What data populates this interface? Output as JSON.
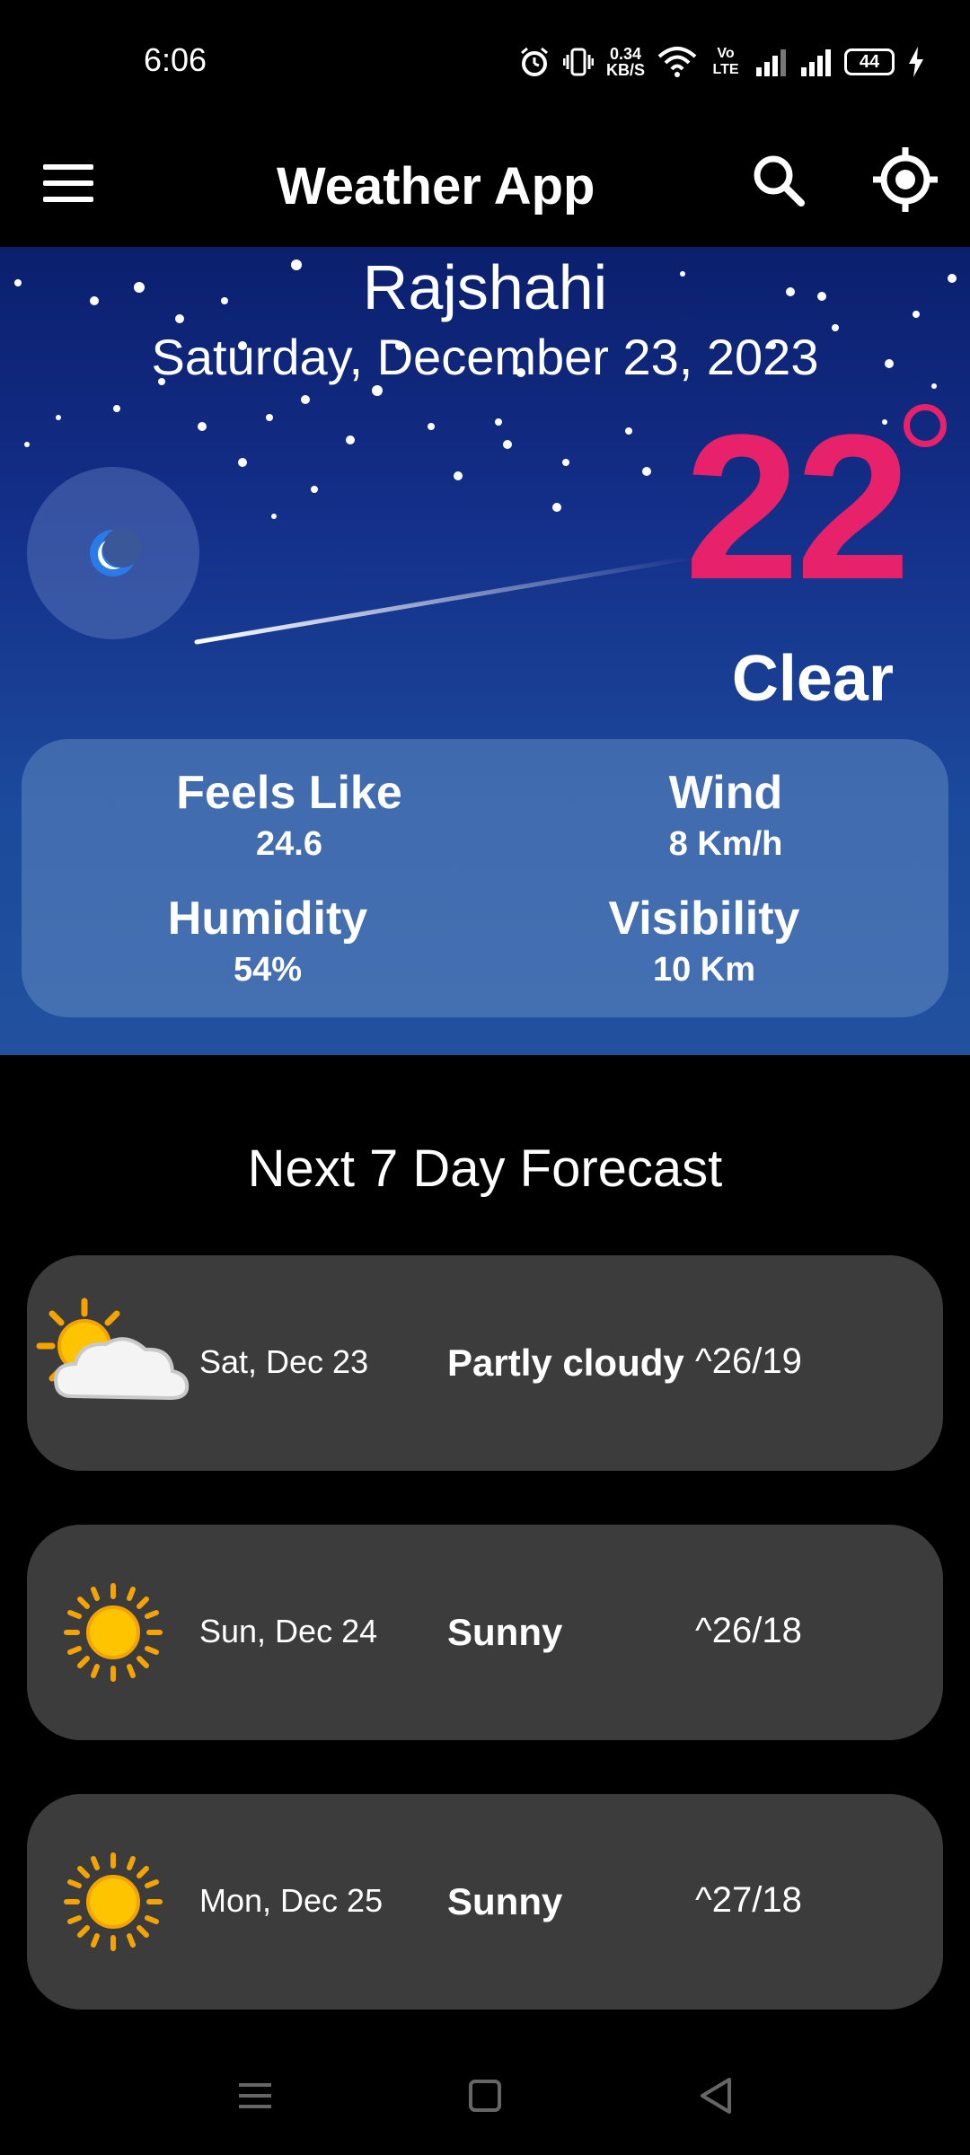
{
  "status_bar": {
    "time": "6:06",
    "net_speed_value": "0.34",
    "net_speed_unit": "KB/S",
    "volte_label": "Vo LTE",
    "battery": "44",
    "icons": [
      "alarm-icon",
      "vibrate-icon",
      "wifi-icon",
      "signal-icon",
      "battery-icon",
      "charging-icon"
    ]
  },
  "app_bar": {
    "title": "Weather App",
    "icons": [
      "menu-icon",
      "search-icon",
      "locate-icon"
    ]
  },
  "current": {
    "city": "Rajshahi",
    "date": "Saturday, December 23, 2023",
    "temperature": "22",
    "condition": "Clear",
    "icon": "moon-icon",
    "temp_color": "#e8226a"
  },
  "stats": {
    "feels_like_label": "Feels Like",
    "feels_like_value": "24.6",
    "wind_label": "Wind",
    "wind_value": "8 Km/h",
    "humidity_label": "Humidity",
    "humidity_value": "54%",
    "visibility_label": "Visibility",
    "visibility_value": "10 Km"
  },
  "forecast": {
    "title": "Next 7 Day Forecast",
    "days": [
      {
        "date": "Sat, Dec 23",
        "condition": "Partly cloudy",
        "temp": "^26/19",
        "icon": "partly-cloudy-icon"
      },
      {
        "date": "Sun, Dec 24",
        "condition": "Sunny",
        "temp": "^26/18",
        "icon": "sun-icon"
      },
      {
        "date": "Mon, Dec 25",
        "condition": "Sunny",
        "temp": "^27/18",
        "icon": "sun-icon"
      }
    ]
  },
  "nav_bar": {
    "icons": [
      "recents-icon",
      "home-icon",
      "back-icon"
    ]
  }
}
